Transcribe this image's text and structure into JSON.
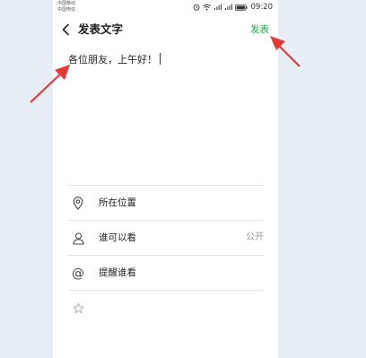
{
  "status_bar": {
    "carrier_1": "中国移动",
    "carrier_2": "中国电信",
    "time": "09:20",
    "icons": [
      "alarm-icon",
      "wifi-icon",
      "signal-icon",
      "signal-icon",
      "battery-icon"
    ]
  },
  "header": {
    "title": "发表文字",
    "publish_label": "发表",
    "back_icon": "chevron-left-icon"
  },
  "editor": {
    "text": "各位朋友，上午好！"
  },
  "options": {
    "location": {
      "label": "所在位置",
      "icon": "location-pin-icon"
    },
    "visibility": {
      "label": "谁可以看",
      "value": "公开",
      "icon": "person-icon"
    },
    "mention": {
      "label": "提醒谁看",
      "icon": "at-icon"
    },
    "extra": {
      "icon": "star-icon"
    }
  },
  "colors": {
    "accent": "#25a244",
    "annotation_arrow": "#e53935",
    "background": "#e7eef6"
  }
}
